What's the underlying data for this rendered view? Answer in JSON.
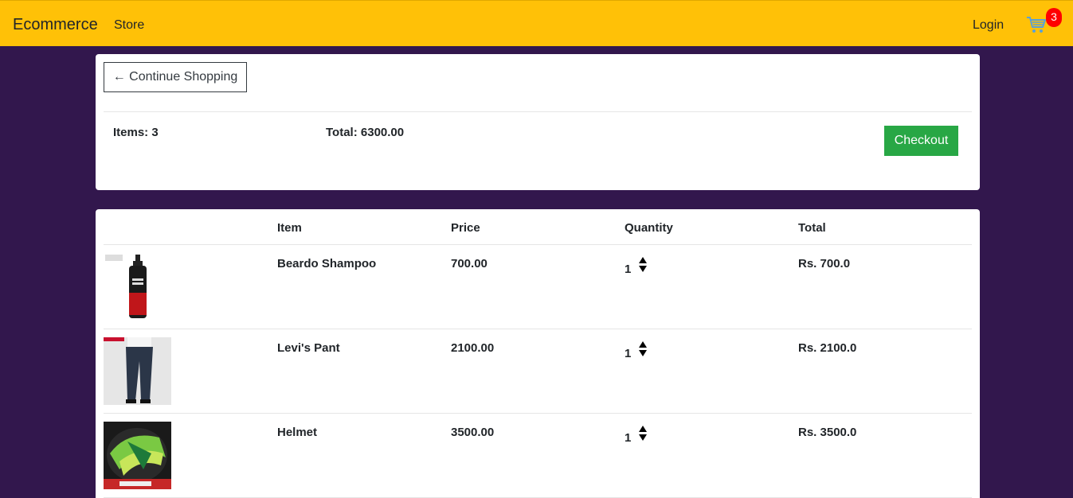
{
  "navbar": {
    "brand": "Ecommerce",
    "store_link": "Store",
    "login_link": "Login",
    "cart_count": "3",
    "bg_color": "#ffc107"
  },
  "summary": {
    "continue_label": "← Continue Shopping",
    "items_text": "Items: 3",
    "total_text": "Total: 6300.00",
    "checkout_label": "Checkout"
  },
  "table": {
    "headers": [
      "",
      "Item",
      "Price",
      "Quantity",
      "Total"
    ],
    "rows": [
      {
        "image": "shampoo-bottle",
        "name": "Beardo Shampoo",
        "price": "700.00",
        "quantity": "1",
        "total": "Rs. 700.0"
      },
      {
        "image": "jeans-photo",
        "name": "Levi's Pant",
        "price": "2100.00",
        "quantity": "1",
        "total": "Rs. 2100.0"
      },
      {
        "image": "helmet-photo",
        "name": "Helmet",
        "price": "3500.00",
        "quantity": "1",
        "total": "Rs. 3500.0"
      }
    ]
  },
  "colors": {
    "page_bg": "#32174d",
    "checkout": "#28a745",
    "badge": "#ff0000"
  }
}
